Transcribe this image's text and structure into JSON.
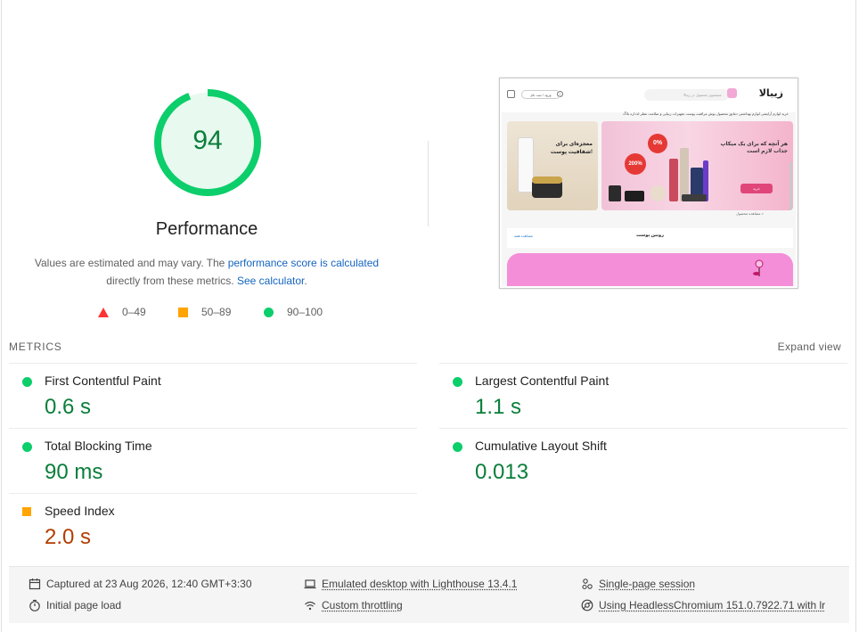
{
  "gauge": {
    "score": "94",
    "score_value": 94,
    "color": "#0cce6b"
  },
  "performance": {
    "title": "Performance",
    "desc_prefix": "Values are estimated and may vary. The",
    "desc_link1": "performance score is calculated",
    "desc_middle": "directly from these metrics.",
    "desc_link2": "See calculator",
    "desc_suffix": "."
  },
  "legend": [
    {
      "label": "0–49",
      "icon": "triangle-fail-icon",
      "color": "#ff3333"
    },
    {
      "label": "50–89",
      "icon": "square-average-icon",
      "color": "#ffa400"
    },
    {
      "label": "90–100",
      "icon": "circle-pass-icon",
      "color": "#0cce6b"
    }
  ],
  "thumbnail": {
    "logo": "زیبالا",
    "search_placeholder": "جستجوی محصول در زیبالا",
    "login_label": "ورود / ثبت نام",
    "nav": "خرید لوازم آرایشی    لوازم بهداشتی    دمایق محصول پوش    مراقبت پوست    تجهیزات زیبایی و سلامت    عطر    لذذاره بلاگ",
    "banner_text": "هر آنچه که برای یک میکاپ جذاب لازم است",
    "shop_label": "خرید",
    "badge1": "0%",
    "badge2": "200%",
    "small_banner_text": "معجزه‌ای برای شفافیت پوست!",
    "more_label": "مشاهده محصول >",
    "section_title": "روتین پوست",
    "section_link": "مشاهده همه"
  },
  "metrics": {
    "heading": "METRICS",
    "expand_label": "Expand view",
    "items": [
      {
        "title": "First Contentful Paint",
        "value": "0.6 s",
        "status": "good"
      },
      {
        "title": "Largest Contentful Paint",
        "value": "1.1 s",
        "status": "good"
      },
      {
        "title": "Total Blocking Time",
        "value": "90 ms",
        "status": "good"
      },
      {
        "title": "Cumulative Layout Shift",
        "value": "0.013",
        "status": "good"
      },
      {
        "title": "Speed Index",
        "value": "2.0 s",
        "status": "average"
      }
    ]
  },
  "info": {
    "captured": "Captured at 23 Aug 2026, 12:40 GMT+3:30",
    "initial_load": "Initial page load",
    "emulated": "Emulated desktop with Lighthouse 13.4.1",
    "throttling": "Custom throttling",
    "session": "Single-page session",
    "browser": "Using HeadlessChromium 151.0.7922.71 with lr"
  },
  "colors": {
    "pass": "#0cce6b",
    "average": "#ffa400",
    "fail": "#ff3333",
    "link": "#1565c0"
  }
}
